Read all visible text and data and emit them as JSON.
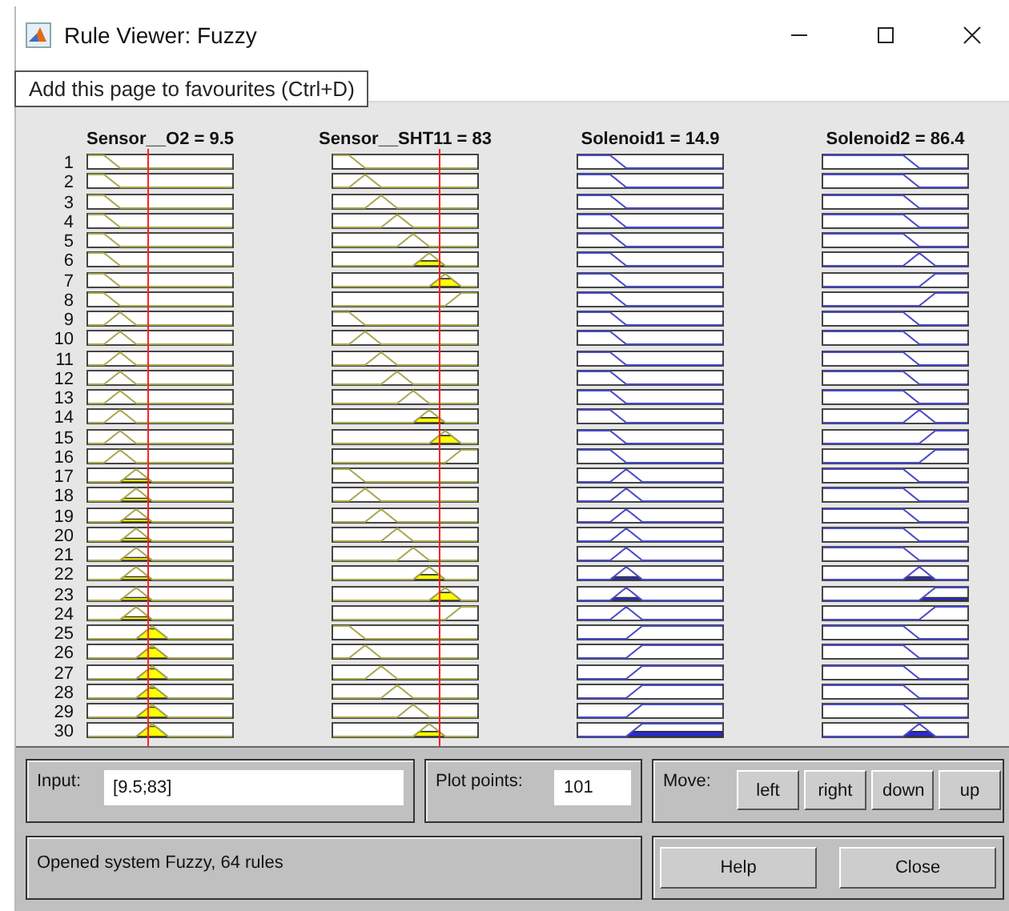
{
  "window": {
    "title": "Rule Viewer: Fuzzy"
  },
  "tooltip": "Add this page to favourites (Ctrl+D)",
  "variables": [
    {
      "name": "Sensor__O2 = 9.5",
      "kind": "input",
      "level": 0.42
    },
    {
      "name": "Sensor__SHT11 = 83",
      "kind": "input",
      "level": 0.735
    },
    {
      "name": "Solenoid1 = 14.9",
      "kind": "output"
    },
    {
      "name": "Solenoid2 = 86.4",
      "kind": "output"
    }
  ],
  "rules": [
    {
      "number": "1",
      "cells": [
        {
          "kind": "falling2"
        },
        {
          "kind": "falling2"
        },
        {
          "kind": "falling3"
        },
        {
          "kind": "falling6"
        }
      ]
    },
    {
      "number": "2",
      "cells": [
        {
          "kind": "falling2"
        },
        {
          "kind": "peak2"
        },
        {
          "kind": "falling3"
        },
        {
          "kind": "falling6"
        }
      ]
    },
    {
      "number": "3",
      "cells": [
        {
          "kind": "falling2"
        },
        {
          "kind": "peak3"
        },
        {
          "kind": "falling3"
        },
        {
          "kind": "falling6"
        }
      ]
    },
    {
      "number": "4",
      "cells": [
        {
          "kind": "falling2"
        },
        {
          "kind": "peak4"
        },
        {
          "kind": "falling3"
        },
        {
          "kind": "falling6"
        }
      ]
    },
    {
      "number": "5",
      "cells": [
        {
          "kind": "falling2"
        },
        {
          "kind": "peak5"
        },
        {
          "kind": "falling3"
        },
        {
          "kind": "falling6"
        }
      ]
    },
    {
      "number": "6",
      "cells": [
        {
          "kind": "falling2"
        },
        {
          "kind": "peak6"
        },
        {
          "kind": "falling3"
        },
        {
          "kind": "peak6"
        }
      ]
    },
    {
      "number": "7",
      "cells": [
        {
          "kind": "falling2"
        },
        {
          "kind": "peak7"
        },
        {
          "kind": "falling3"
        },
        {
          "kind": "rising7"
        }
      ]
    },
    {
      "number": "8",
      "cells": [
        {
          "kind": "falling2"
        },
        {
          "kind": "rising8"
        },
        {
          "kind": "falling3"
        },
        {
          "kind": "rising7"
        }
      ]
    },
    {
      "number": "9",
      "cells": [
        {
          "kind": "peak2"
        },
        {
          "kind": "falling2"
        },
        {
          "kind": "falling3"
        },
        {
          "kind": "falling6"
        }
      ]
    },
    {
      "number": "10",
      "cells": [
        {
          "kind": "peak2"
        },
        {
          "kind": "peak2"
        },
        {
          "kind": "falling3"
        },
        {
          "kind": "falling6"
        }
      ]
    },
    {
      "number": "11",
      "cells": [
        {
          "kind": "peak2"
        },
        {
          "kind": "peak3"
        },
        {
          "kind": "falling3"
        },
        {
          "kind": "falling6"
        }
      ]
    },
    {
      "number": "12",
      "cells": [
        {
          "kind": "peak2"
        },
        {
          "kind": "peak4"
        },
        {
          "kind": "falling3"
        },
        {
          "kind": "falling6"
        }
      ]
    },
    {
      "number": "13",
      "cells": [
        {
          "kind": "peak2"
        },
        {
          "kind": "peak5"
        },
        {
          "kind": "falling3"
        },
        {
          "kind": "falling6"
        }
      ]
    },
    {
      "number": "14",
      "cells": [
        {
          "kind": "peak2"
        },
        {
          "kind": "peak6"
        },
        {
          "kind": "falling3"
        },
        {
          "kind": "peak6"
        }
      ]
    },
    {
      "number": "15",
      "cells": [
        {
          "kind": "peak2"
        },
        {
          "kind": "peak7"
        },
        {
          "kind": "falling3"
        },
        {
          "kind": "rising7"
        }
      ]
    },
    {
      "number": "16",
      "cells": [
        {
          "kind": "peak2"
        },
        {
          "kind": "rising8"
        },
        {
          "kind": "falling3"
        },
        {
          "kind": "rising7"
        }
      ]
    },
    {
      "number": "17",
      "cells": [
        {
          "kind": "peak3"
        },
        {
          "kind": "falling2"
        },
        {
          "kind": "peak3"
        },
        {
          "kind": "falling6"
        }
      ]
    },
    {
      "number": "18",
      "cells": [
        {
          "kind": "peak3"
        },
        {
          "kind": "peak2"
        },
        {
          "kind": "peak3"
        },
        {
          "kind": "falling6"
        }
      ]
    },
    {
      "number": "19",
      "cells": [
        {
          "kind": "peak3"
        },
        {
          "kind": "peak3"
        },
        {
          "kind": "peak3"
        },
        {
          "kind": "falling6"
        }
      ]
    },
    {
      "number": "20",
      "cells": [
        {
          "kind": "peak3"
        },
        {
          "kind": "peak4"
        },
        {
          "kind": "peak3"
        },
        {
          "kind": "falling6"
        }
      ]
    },
    {
      "number": "21",
      "cells": [
        {
          "kind": "peak3"
        },
        {
          "kind": "peak5"
        },
        {
          "kind": "peak3"
        },
        {
          "kind": "falling6"
        }
      ]
    },
    {
      "number": "22",
      "cells": [
        {
          "kind": "peak3"
        },
        {
          "kind": "peak6"
        },
        {
          "kind": "peak3"
        },
        {
          "kind": "peak6"
        }
      ]
    },
    {
      "number": "23",
      "cells": [
        {
          "kind": "peak3"
        },
        {
          "kind": "peak7"
        },
        {
          "kind": "peak3"
        },
        {
          "kind": "rising7"
        }
      ]
    },
    {
      "number": "24",
      "cells": [
        {
          "kind": "peak3"
        },
        {
          "kind": "rising8"
        },
        {
          "kind": "peak3"
        },
        {
          "kind": "rising7"
        }
      ]
    },
    {
      "number": "25",
      "cells": [
        {
          "kind": "peak4"
        },
        {
          "kind": "falling2"
        },
        {
          "kind": "rising4"
        },
        {
          "kind": "falling6"
        }
      ]
    },
    {
      "number": "26",
      "cells": [
        {
          "kind": "peak4"
        },
        {
          "kind": "peak2"
        },
        {
          "kind": "rising4"
        },
        {
          "kind": "falling6"
        }
      ]
    },
    {
      "number": "27",
      "cells": [
        {
          "kind": "peak4"
        },
        {
          "kind": "peak3"
        },
        {
          "kind": "rising4"
        },
        {
          "kind": "falling6"
        }
      ]
    },
    {
      "number": "28",
      "cells": [
        {
          "kind": "peak4"
        },
        {
          "kind": "peak4"
        },
        {
          "kind": "rising4"
        },
        {
          "kind": "falling6"
        }
      ]
    },
    {
      "number": "29",
      "cells": [
        {
          "kind": "peak4"
        },
        {
          "kind": "peak5"
        },
        {
          "kind": "rising4"
        },
        {
          "kind": "falling6"
        }
      ]
    },
    {
      "number": "30",
      "cells": [
        {
          "kind": "peak4"
        },
        {
          "kind": "peak6"
        },
        {
          "kind": "rising4"
        },
        {
          "kind": "peak6"
        }
      ]
    }
  ],
  "controls": {
    "input": {
      "label": "Input:",
      "value": "[9.5;83]"
    },
    "plot_points": {
      "label": "Plot points:",
      "value": "101"
    },
    "move": {
      "label": "Move:",
      "buttons": [
        "left",
        "right",
        "down",
        "up"
      ]
    }
  },
  "status": "Opened system Fuzzy, 64 rules",
  "buttons": [
    "Help",
    "Close"
  ]
}
